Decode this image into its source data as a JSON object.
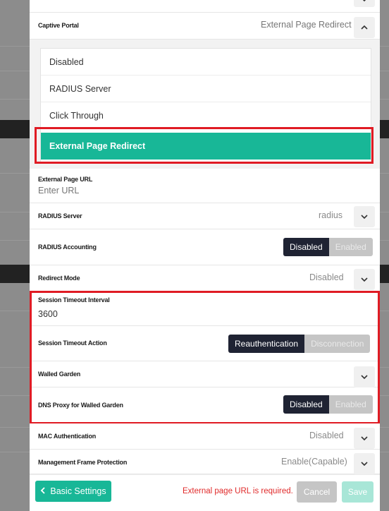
{
  "captive_portal": {
    "label": "Captive Portal",
    "value": "External Page Redirect",
    "options": [
      "Disabled",
      "RADIUS Server",
      "Click Through",
      "External Page Redirect"
    ],
    "selected": "External Page Redirect"
  },
  "external_page_url": {
    "label": "External Page URL",
    "placeholder": "Enter URL"
  },
  "radius_server": {
    "label": "RADIUS Server",
    "value": "radius"
  },
  "radius_accounting": {
    "label": "RADIUS Accounting",
    "on_label": "Disabled",
    "off_label": "Enabled",
    "selected": "Disabled"
  },
  "redirect_mode": {
    "label": "Redirect Mode",
    "value": "Disabled"
  },
  "session_timeout_interval": {
    "label": "Session Timeout Interval",
    "value": "3600"
  },
  "session_timeout_action": {
    "label": "Session Timeout Action",
    "on_label": "Reauthentication",
    "off_label": "Disconnection",
    "selected": "Reauthentication"
  },
  "walled_garden": {
    "label": "Walled Garden"
  },
  "dns_proxy": {
    "label": "DNS Proxy for Walled Garden",
    "on_label": "Disabled",
    "off_label": "Enabled",
    "selected": "Disabled"
  },
  "mac_authentication": {
    "label": "MAC Authentication",
    "value": "Disabled"
  },
  "management_frame_protection": {
    "label": "Management Frame Protection",
    "value": "Enable(Capable)"
  },
  "footer": {
    "back_label": "Basic Settings",
    "error": "External page URL is required.",
    "cancel_label": "Cancel",
    "save_label": "Save"
  },
  "colors": {
    "accent": "#18b797",
    "highlight": "#e01b24",
    "toggle_active": "#1f2333",
    "error": "#e02a2a"
  },
  "icons": [
    "chevron-up-icon",
    "chevron-down-icon",
    "chevron-left-icon"
  ]
}
